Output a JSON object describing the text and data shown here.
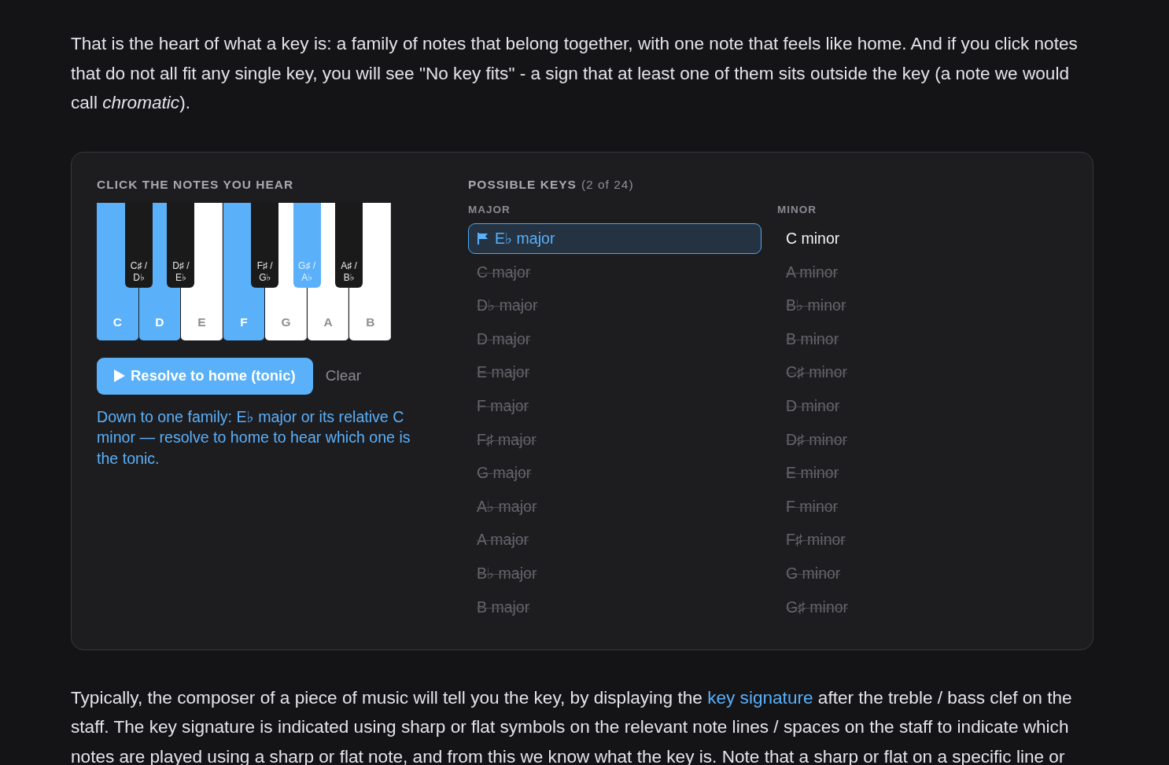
{
  "intro_paragraph": "That is the heart of what a key is: a family of notes that belong together, with one note that feels like home. And if you click notes that do not all fit any single key, you will see \"No key fits\" - a sign that at least one of them sits outside the key (a note we would call *chromatic*).",
  "note_finder": {
    "notes_heading": "CLICK THE NOTES YOU HEAR",
    "piano": {
      "white_keys": [
        {
          "label": "C",
          "selected": true,
          "black_key": {
            "label": "C♯ /\nD♭",
            "selected": false
          }
        },
        {
          "label": "D",
          "selected": true,
          "black_key": {
            "label": "D♯ /\nE♭",
            "selected": false
          }
        },
        {
          "label": "E",
          "selected": false
        },
        {
          "label": "F",
          "selected": true,
          "black_key": {
            "label": "F♯ /\nG♭",
            "selected": false
          }
        },
        {
          "label": "G",
          "selected": false,
          "black_key": {
            "label": "G♯ /\nA♭",
            "selected": true
          }
        },
        {
          "label": "A",
          "selected": false,
          "black_key": {
            "label": "A♯ /\nB♭",
            "selected": false
          }
        },
        {
          "label": "B",
          "selected": false
        }
      ]
    },
    "resolve_button": {
      "label": "Resolve to home (tonic)"
    },
    "clear_button": {
      "label": "Clear"
    },
    "message": "Down to one family: E♭ major or its relative C minor — resolve to home to hear which one is the tonic.",
    "keys_heading": "POSSIBLE KEYS",
    "keys_count": "(2 of 24)",
    "columns": [
      {
        "heading": "MAJOR",
        "keys": [
          {
            "name": "E♭ major",
            "selected": true,
            "possible": true
          },
          {
            "name": "C major",
            "selected": false,
            "possible": false
          },
          {
            "name": "D♭ major",
            "selected": false,
            "possible": false
          },
          {
            "name": "D major",
            "selected": false,
            "possible": false
          },
          {
            "name": "E major",
            "selected": false,
            "possible": false
          },
          {
            "name": "F major",
            "selected": false,
            "possible": false
          },
          {
            "name": "F♯ major",
            "selected": false,
            "possible": false
          },
          {
            "name": "G major",
            "selected": false,
            "possible": false
          },
          {
            "name": "A♭ major",
            "selected": false,
            "possible": false
          },
          {
            "name": "A major",
            "selected": false,
            "possible": false
          },
          {
            "name": "B♭ major",
            "selected": false,
            "possible": false
          },
          {
            "name": "B major",
            "selected": false,
            "possible": false
          }
        ]
      },
      {
        "heading": "MINOR",
        "keys": [
          {
            "name": "C minor",
            "selected": false,
            "possible": true
          },
          {
            "name": "A minor",
            "selected": false,
            "possible": false
          },
          {
            "name": "B♭ minor",
            "selected": false,
            "possible": false
          },
          {
            "name": "B minor",
            "selected": false,
            "possible": false
          },
          {
            "name": "C♯ minor",
            "selected": false,
            "possible": false
          },
          {
            "name": "D minor",
            "selected": false,
            "possible": false
          },
          {
            "name": "D♯ minor",
            "selected": false,
            "possible": false
          },
          {
            "name": "E minor",
            "selected": false,
            "possible": false
          },
          {
            "name": "F minor",
            "selected": false,
            "possible": false
          },
          {
            "name": "F♯ minor",
            "selected": false,
            "possible": false
          },
          {
            "name": "G minor",
            "selected": false,
            "possible": false
          },
          {
            "name": "G♯ minor",
            "selected": false,
            "possible": false
          }
        ]
      }
    ]
  },
  "next_paragraph": {
    "parts": [
      {
        "kind": "text",
        "text": "Typically, the composer of a piece of music will tell you the key, by displaying the "
      },
      {
        "kind": "link",
        "text": "key signature"
      },
      {
        "kind": "text",
        "text": " after the treble / bass clef on the staff. The key signature is indicated using sharp or flat symbols on the relevant note lines / spaces on the staff to indicate which notes are played using a sharp or flat note, and from this we know what the key is. Note that a sharp or flat on a specific line or"
      }
    ]
  }
}
